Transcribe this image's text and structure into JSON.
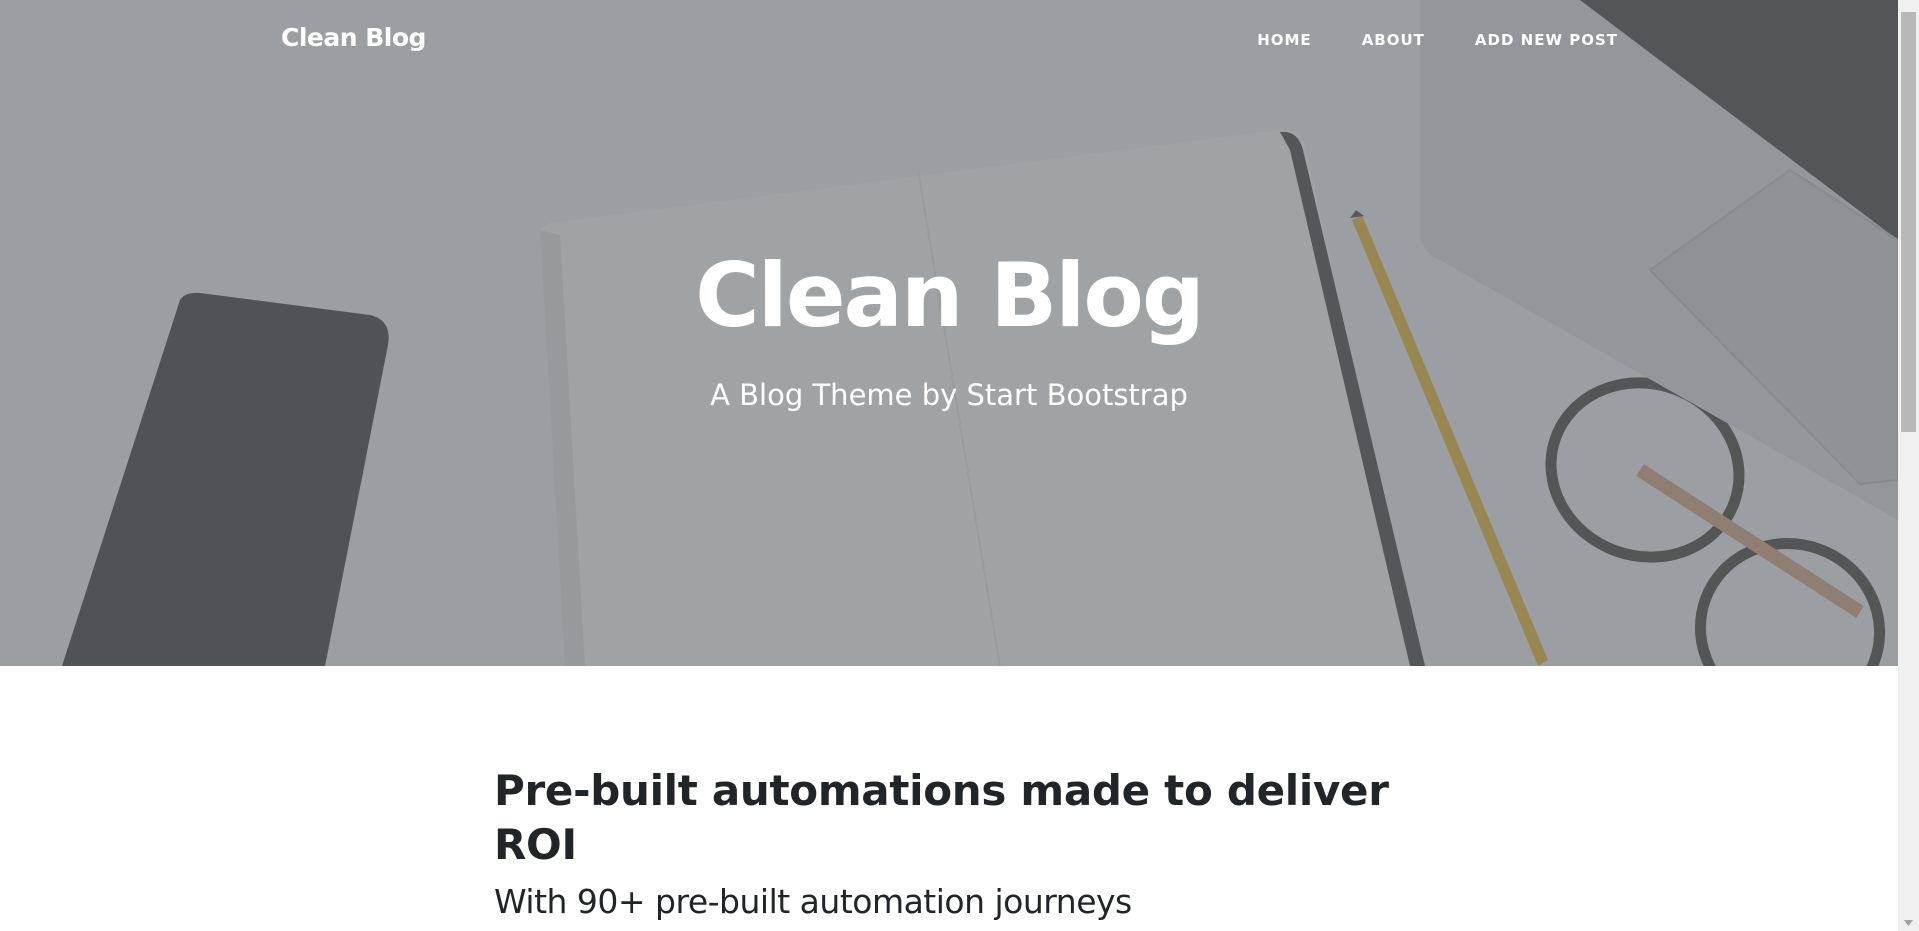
{
  "navbar": {
    "brand": "Clean Blog",
    "links": [
      {
        "label": "HOME"
      },
      {
        "label": "ABOUT"
      },
      {
        "label": "ADD NEW POST"
      }
    ]
  },
  "hero": {
    "title": "Clean Blog",
    "subtitle": "A Blog Theme by Start Bootstrap"
  },
  "posts": [
    {
      "title": "Pre-built automations made to deliver ROI",
      "subtitle": "With 90+ pre-built automation journeys"
    }
  ],
  "colors": {
    "overlay": "#6e7278",
    "text_dark": "#212529",
    "text_light": "#ffffff"
  },
  "icons": {
    "scroll_down": "chevron-down-icon"
  }
}
